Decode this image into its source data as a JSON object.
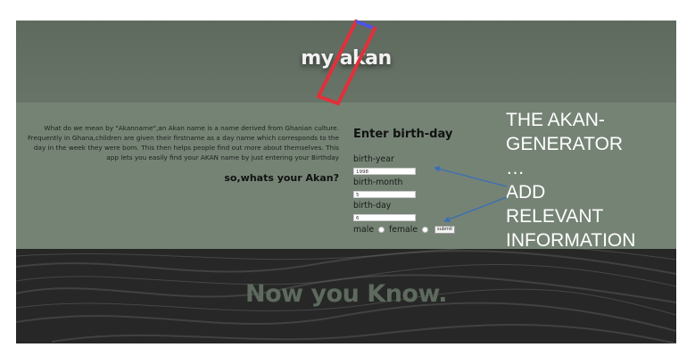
{
  "header": {
    "title": "my akan"
  },
  "description": {
    "text": "What do we mean by \"Akanname\",an Akan name is a name derived from Ghanian culture. Frequently in Ghana,children are given their firstname as a day name which corresponds to the day in the week they were born. This then helps people find out more about themselves. This app lets you easily find your AKAN name by just entering your Birthday",
    "question": "so,whats your Akan?"
  },
  "form": {
    "title": "Enter birth-day",
    "year_label": "birth-year",
    "year_value": "1998",
    "month_label": "birth-month",
    "month_value": "5",
    "day_label": "birth-day",
    "day_value": "6",
    "male_label": "male",
    "female_label": "female",
    "submit_label": "submit"
  },
  "annotation": {
    "lines": [
      "THE AKAN-",
      "GENERATOR",
      "…",
      "ADD",
      "RELEVANT",
      "INFORMATION"
    ],
    "arrow_color": "#3a6fb5",
    "highlight_color": "#e0303a",
    "highlight_accent_color": "#4a56e0"
  },
  "footer": {
    "text": "Now you Know."
  }
}
